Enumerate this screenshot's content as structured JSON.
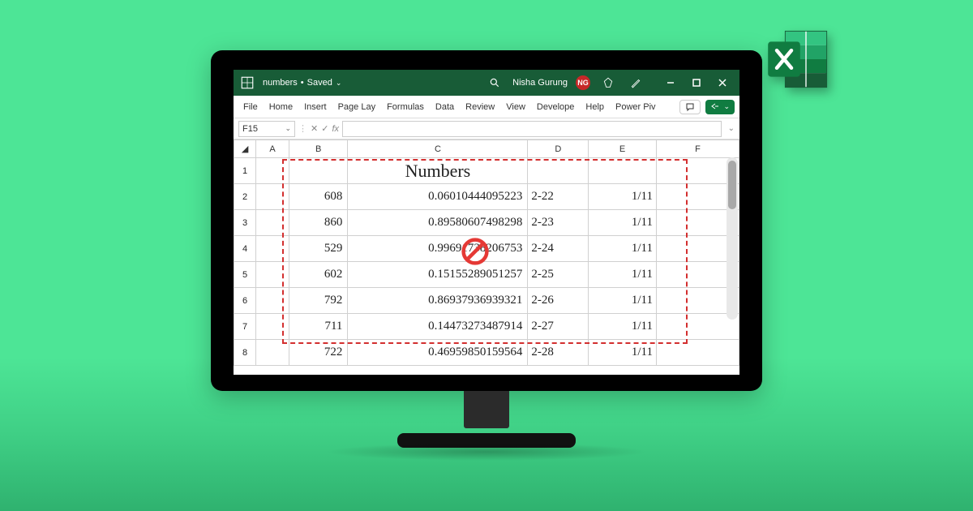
{
  "titlebar": {
    "docname": "numbers",
    "status": "Saved",
    "user": "Nisha Gurung",
    "avatar_initials": "NG"
  },
  "ribbon": {
    "tabs": [
      "File",
      "Home",
      "Insert",
      "Page Lay",
      "Formulas",
      "Data",
      "Review",
      "View",
      "Develope",
      "Help",
      "Power Piv"
    ]
  },
  "formula": {
    "name_box": "F15",
    "fx_label": "fx",
    "value": ""
  },
  "columns": [
    "A",
    "B",
    "C",
    "D",
    "E",
    "F"
  ],
  "row_headers": [
    "1",
    "2",
    "3",
    "4",
    "5",
    "6",
    "7",
    "8"
  ],
  "sheet_title": "Numbers",
  "rows": [
    {
      "b": "608",
      "c": "0.06010444095223",
      "d": "2-22",
      "e": "1/11"
    },
    {
      "b": "860",
      "c": "0.89580607498298",
      "d": "2-23",
      "e": "1/11"
    },
    {
      "b": "529",
      "c": "0.99691738206753",
      "d": "2-24",
      "e": "1/11"
    },
    {
      "b": "602",
      "c": "0.15155289051257",
      "d": "2-25",
      "e": "1/11"
    },
    {
      "b": "792",
      "c": "0.86937936939321",
      "d": "2-26",
      "e": "1/11"
    },
    {
      "b": "711",
      "c": "0.14473273487914",
      "d": "2-27",
      "e": "1/11"
    },
    {
      "b": "722",
      "c": "0.46959850159564",
      "d": "2-28",
      "e": "1/11"
    }
  ]
}
